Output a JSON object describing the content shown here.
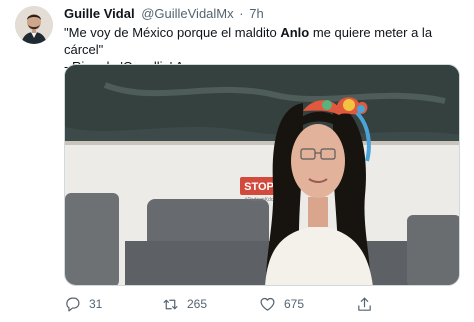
{
  "tweet": {
    "author_name": "Guille Vidal",
    "author_handle": "@GuilleVidalMx",
    "separator": "·",
    "time": "7h",
    "text_before": "\"Me voy de México porque el maldito ",
    "text_bold": "Anlo",
    "text_after": " me quiere meter a la cárcel\"",
    "text_line2": "- Ricardo 'Canallin' Anaya."
  },
  "media": {
    "stop_sign_text": "STOP",
    "stop_sign_subtext": "#PedoenKdc"
  },
  "actions": {
    "reply_count": "31",
    "retweet_count": "265",
    "like_count": "675"
  },
  "colors": {
    "text_primary": "#0f1419",
    "text_secondary": "#536471",
    "wall": "#eceae6",
    "couch": "#6a6d70",
    "stop_red": "#d24a3c"
  },
  "icons": {
    "reply": "reply-icon",
    "retweet": "retweet-icon",
    "like": "heart-icon",
    "share": "share-icon"
  }
}
